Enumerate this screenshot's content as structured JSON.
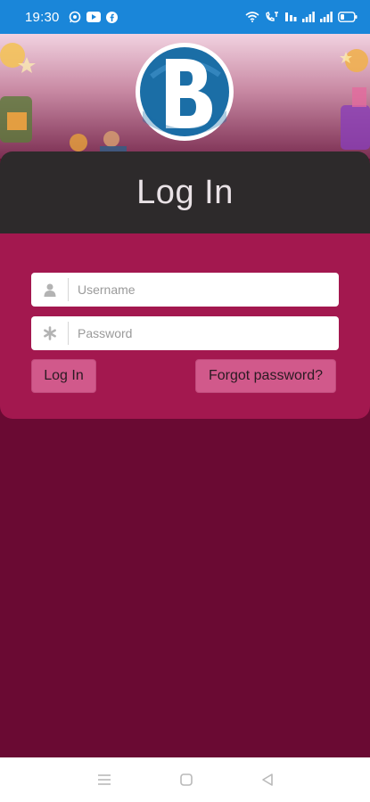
{
  "status_bar": {
    "time": "19:30",
    "battery": "20"
  },
  "login": {
    "title": "Log In",
    "username_placeholder": "Username",
    "password_placeholder": "Password",
    "login_button": "Log In",
    "forgot_button": "Forgot password?"
  },
  "colors": {
    "status_bar": "#1a86d9",
    "page_background": "#6a0a33",
    "card_background": "#a3184f",
    "card_header": "#2d2a2b",
    "button": "#d1598b"
  },
  "icons": {
    "username": "user-icon",
    "password": "asterisk-icon",
    "logo": "b-logo"
  }
}
